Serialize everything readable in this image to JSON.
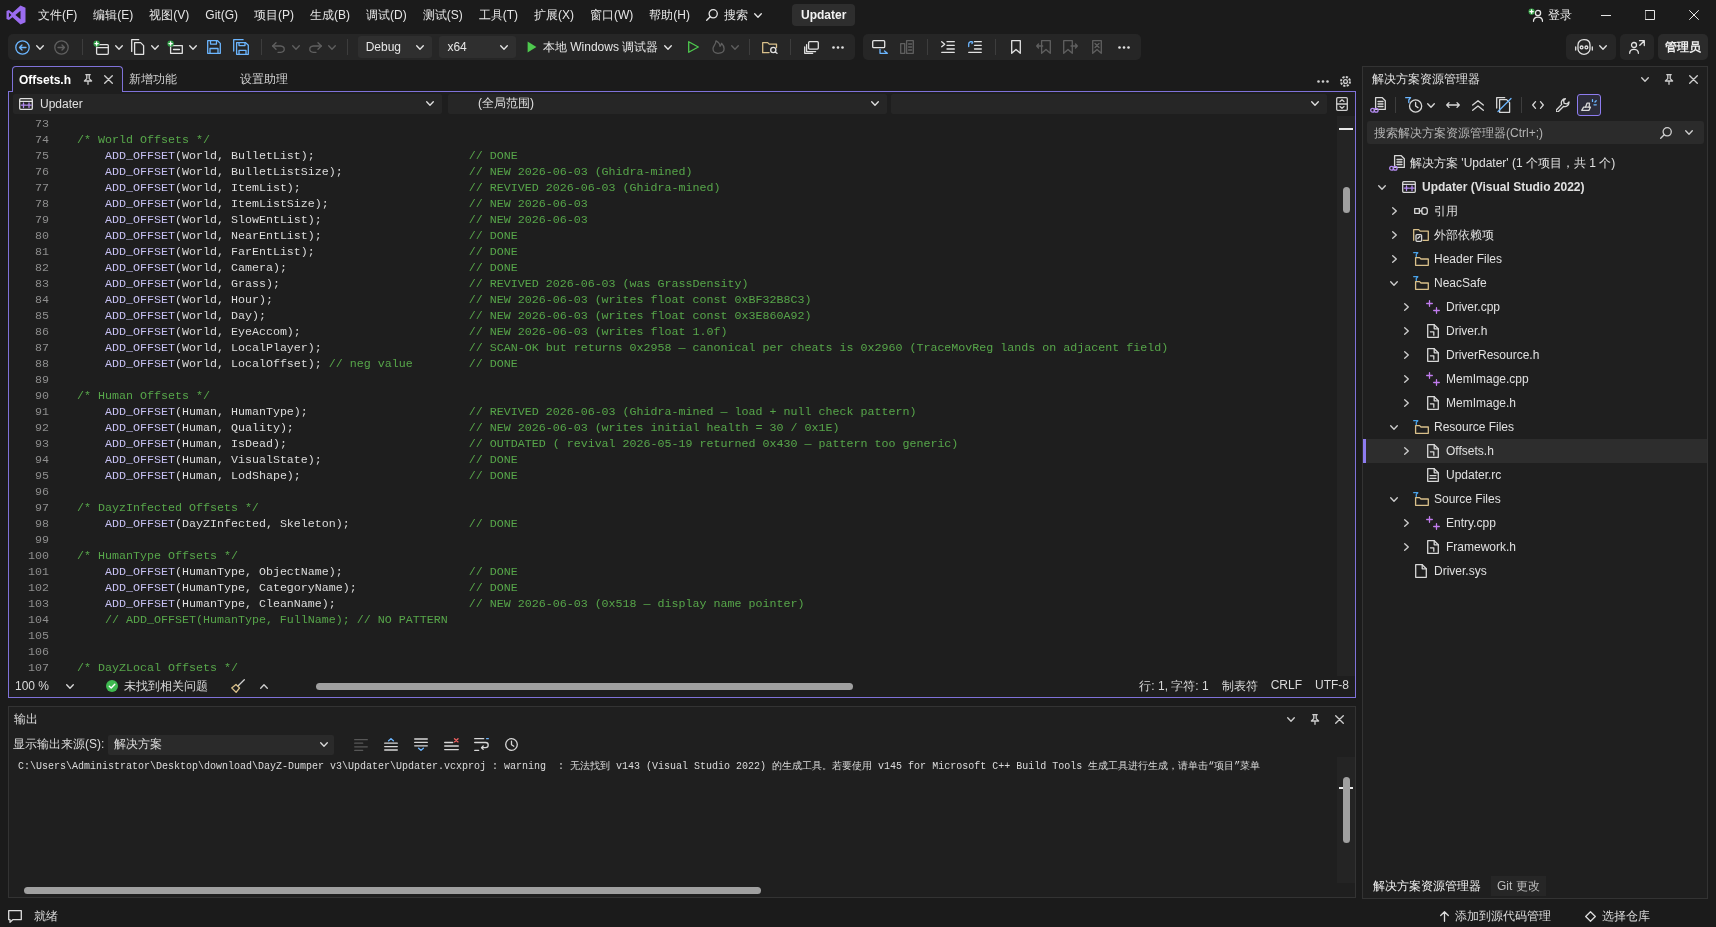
{
  "menu_bar": {
    "items": [
      "文件(F)",
      "编辑(E)",
      "视图(V)",
      "Git(G)",
      "项目(P)",
      "生成(B)",
      "调试(D)",
      "测试(S)",
      "工具(T)",
      "扩展(X)",
      "窗口(W)",
      "帮助(H)"
    ],
    "search": "搜索",
    "solution_name": "Updater",
    "sign_in": "登录"
  },
  "toolbar": {
    "items": [
      {
        "kind": "back",
        "disabled": false
      },
      {
        "kind": "forward",
        "disabled": true
      },
      {
        "kind": "separator"
      },
      {
        "kind": "new-project",
        "disabled": false
      },
      {
        "kind": "open-file",
        "disabled": false
      },
      {
        "kind": "add-item",
        "disabled": false
      },
      {
        "kind": "save",
        "disabled": false
      },
      {
        "kind": "save-all",
        "disabled": false
      },
      {
        "kind": "separator"
      },
      {
        "kind": "undo",
        "disabled": true
      },
      {
        "kind": "redo",
        "disabled": true
      },
      {
        "kind": "separator"
      },
      {
        "kind": "configuration",
        "value": "Debug"
      },
      {
        "kind": "platform",
        "value": "x64"
      },
      {
        "kind": "start",
        "label": "本地 Windows 调试器"
      },
      {
        "kind": "start-without-debugging",
        "disabled": false
      },
      {
        "kind": "hot-reload",
        "disabled": true
      },
      {
        "kind": "separator"
      },
      {
        "kind": "find-in-files",
        "disabled": false
      },
      {
        "kind": "separator"
      },
      {
        "kind": "window",
        "disabled": false
      },
      {
        "kind": "more"
      }
    ],
    "editor_items": [
      {
        "kind": "comment",
        "disabled": false
      },
      {
        "kind": "uncomment",
        "disabled": true
      },
      {
        "kind": "separator"
      },
      {
        "kind": "outdent",
        "disabled": false
      },
      {
        "kind": "indent",
        "disabled": false
      },
      {
        "kind": "separator"
      },
      {
        "kind": "bookmark",
        "disabled": false
      },
      {
        "kind": "previous-bookmark",
        "disabled": true
      },
      {
        "kind": "next-bookmark",
        "disabled": true
      },
      {
        "kind": "clear-bookmarks",
        "disabled": true
      },
      {
        "kind": "more"
      }
    ],
    "account": "管理员"
  },
  "document_tabs": [
    {
      "label": "Offsets.h",
      "selected": true
    },
    {
      "label": "新增功能",
      "selected": false
    },
    {
      "label": "设置助理",
      "selected": false
    }
  ],
  "editor": {
    "navigation": {
      "project": "Updater",
      "scope": "(全局范围)"
    },
    "lines": [
      {
        "number": "73",
        "kind": "blank"
      },
      {
        "number": "74",
        "kind": "heading",
        "text": "/* World Offsets */"
      },
      {
        "number": "75",
        "kind": "call",
        "macro": "ADD_OFFSET",
        "args": "(World, BulletList);",
        "note": "// DONE"
      },
      {
        "number": "76",
        "kind": "call",
        "macro": "ADD_OFFSET",
        "args": "(World, BulletListSize);",
        "note": "// NEW 2026-06-03 (Ghidra-mined)"
      },
      {
        "number": "77",
        "kind": "call",
        "macro": "ADD_OFFSET",
        "args": "(World, ItemList);",
        "note": "// REVIVED 2026-06-03 (Ghidra-mined)"
      },
      {
        "number": "78",
        "kind": "call",
        "macro": "ADD_OFFSET",
        "args": "(World, ItemListSize);",
        "note": "// NEW 2026-06-03"
      },
      {
        "number": "79",
        "kind": "call",
        "macro": "ADD_OFFSET",
        "args": "(World, SlowEntList);",
        "note": "// NEW 2026-06-03"
      },
      {
        "number": "80",
        "kind": "call",
        "macro": "ADD_OFFSET",
        "args": "(World, NearEntList);",
        "note": "// DONE"
      },
      {
        "number": "81",
        "kind": "call",
        "macro": "ADD_OFFSET",
        "args": "(World, FarEntList);",
        "note": "// DONE"
      },
      {
        "number": "82",
        "kind": "call",
        "macro": "ADD_OFFSET",
        "args": "(World, Camera);",
        "note": "// DONE"
      },
      {
        "number": "83",
        "kind": "call",
        "macro": "ADD_OFFSET",
        "args": "(World, Grass);",
        "note": "// REVIVED 2026-06-03 (was GrassDensity)"
      },
      {
        "number": "84",
        "kind": "call",
        "macro": "ADD_OFFSET",
        "args": "(World, Hour);",
        "note": "// NEW 2026-06-03 (writes float const 0xBF32B8C3)"
      },
      {
        "number": "85",
        "kind": "call",
        "macro": "ADD_OFFSET",
        "args": "(World, Day);",
        "note": "// NEW 2026-06-03 (writes float const 0x3E860A92)"
      },
      {
        "number": "86",
        "kind": "call",
        "macro": "ADD_OFFSET",
        "args": "(World, EyeAccom);",
        "note": "// NEW 2026-06-03 (writes float 1.0f)"
      },
      {
        "number": "87",
        "kind": "call",
        "macro": "ADD_OFFSET",
        "args": "(World, LocalPlayer);",
        "note": "// SCAN-OK but returns 0x2958 — canonical per cheats is 0x2960 (TraceMovReg lands on adjacent field)"
      },
      {
        "number": "88",
        "kind": "call",
        "macro": "ADD_OFFSET",
        "args": "(World, LocalOffset);",
        "inline_comment": "// neg value",
        "note": "// DONE"
      },
      {
        "number": "89",
        "kind": "blank"
      },
      {
        "number": "90",
        "kind": "heading",
        "text": "/* Human Offsets */"
      },
      {
        "number": "91",
        "kind": "call",
        "macro": "ADD_OFFSET",
        "args": "(Human, HumanType);",
        "note": "// REVIVED 2026-06-03 (Ghidra-mined — load + null check pattern)"
      },
      {
        "number": "92",
        "kind": "call",
        "macro": "ADD_OFFSET",
        "args": "(Human, Quality);",
        "note": "// NEW 2026-06-03 (writes initial health = 30 / 0x1E)"
      },
      {
        "number": "93",
        "kind": "call",
        "macro": "ADD_OFFSET",
        "args": "(Human, IsDead);",
        "note": "// OUTDATED ( revival 2026-05-19 returned 0x430 — pattern too generic)"
      },
      {
        "number": "94",
        "kind": "call",
        "macro": "ADD_OFFSET",
        "args": "(Human, VisualState);",
        "note": "// DONE"
      },
      {
        "number": "95",
        "kind": "call",
        "macro": "ADD_OFFSET",
        "args": "(Human, LodShape);",
        "note": "// DONE"
      },
      {
        "number": "96",
        "kind": "blank"
      },
      {
        "number": "97",
        "kind": "heading",
        "text": "/* DayzInfected Offsets */"
      },
      {
        "number": "98",
        "kind": "call",
        "macro": "ADD_OFFSET",
        "args": "(DayZInfected, Skeleton);",
        "note": "// DONE"
      },
      {
        "number": "99",
        "kind": "blank"
      },
      {
        "number": "100",
        "kind": "heading",
        "text": "/* HumanType Offsets */"
      },
      {
        "number": "101",
        "kind": "call",
        "macro": "ADD_OFFSET",
        "args": "(HumanType, ObjectName);",
        "note": "// DONE"
      },
      {
        "number": "102",
        "kind": "call",
        "macro": "ADD_OFFSET",
        "args": "(HumanType, CategoryName);",
        "note": "// DONE"
      },
      {
        "number": "103",
        "kind": "call",
        "macro": "ADD_OFFSET",
        "args": "(HumanType, CleanName);",
        "note": "// NEW 2026-06-03 (0x518 — display name pointer)"
      },
      {
        "number": "104",
        "kind": "disabled",
        "text": "// ADD_OFFSET(HumanType, FullName); // NO PATTERN"
      },
      {
        "number": "105",
        "kind": "blank"
      },
      {
        "number": "106",
        "kind": "blank"
      },
      {
        "number": "107",
        "kind": "heading",
        "text": "/* DayZLocal Offsets */"
      }
    ],
    "status": {
      "zoom": "100 %",
      "issues": "未找到相关问题",
      "position": "行: 1, 字符: 1",
      "indentation": "制表符",
      "line_ending": "CRLF",
      "encoding": "UTF-8"
    }
  },
  "output": {
    "title": "输出",
    "source_label": "显示输出来源(S):",
    "source": "解决方案",
    "toolbar": [
      {
        "kind": "align",
        "disabled": true
      },
      {
        "kind": "previous",
        "disabled": false
      },
      {
        "kind": "next",
        "disabled": false
      },
      {
        "kind": "clear",
        "disabled": false
      },
      {
        "kind": "wrap",
        "disabled": false
      },
      {
        "kind": "timestamp",
        "disabled": false
      }
    ],
    "lines": [
      "C:\\Users\\Administrator\\Desktop\\download\\DayZ-Dumper v3\\Updater\\Updater.vcxproj : warning  : 无法找到 v143 (Visual Studio 2022) 的生成工具。若要使用 v145 for Microsoft C++ Build Tools 生成工具进行生成，请单击“项目”菜单"
    ]
  },
  "solution_explorer": {
    "title": "解决方案资源管理器",
    "toolbar": [
      {
        "kind": "switch-views",
        "on": false
      },
      {
        "kind": "pending-changes",
        "on": false
      },
      {
        "kind": "sync",
        "on": false
      },
      {
        "kind": "collapse",
        "on": false
      },
      {
        "kind": "show-all",
        "on": false
      },
      {
        "kind": "view-code",
        "on": false
      },
      {
        "kind": "properties",
        "on": false
      },
      {
        "kind": "preview",
        "on": true
      }
    ],
    "search": {
      "placeholder": "搜索解决方案资源管理器(Ctrl+;)"
    },
    "tree": [
      {
        "label": "解决方案 'Updater' (1 个项目，共 1 个)",
        "kind": "solution",
        "selected": false,
        "children": [
          {
            "label": "Updater (Visual Studio 2022)",
            "kind": "project",
            "expanded": true,
            "selected": false,
            "children": [
              {
                "label": "引用",
                "kind": "references",
                "expanded": false,
                "selected": false
              },
              {
                "label": "外部依赖项",
                "kind": "dependencies",
                "expanded": false,
                "selected": false
              },
              {
                "label": "Header Files",
                "kind": "filter",
                "expanded": false,
                "selected": false
              },
              {
                "label": "NeacSafe",
                "kind": "filter",
                "expanded": true,
                "selected": false,
                "children": [
                  {
                    "label": "Driver.cpp",
                    "kind": "cpp",
                    "expanded": false,
                    "selected": false
                  },
                  {
                    "label": "Driver.h",
                    "kind": "header",
                    "expanded": false,
                    "selected": false
                  },
                  {
                    "label": "DriverResource.h",
                    "kind": "header",
                    "expanded": false,
                    "selected": false
                  },
                  {
                    "label": "MemImage.cpp",
                    "kind": "cpp",
                    "expanded": false,
                    "selected": false
                  },
                  {
                    "label": "MemImage.h",
                    "kind": "header",
                    "expanded": false,
                    "selected": false
                  }
                ]
              },
              {
                "label": "Resource Files",
                "kind": "filter",
                "expanded": true,
                "selected": false,
                "children": [
                  {
                    "label": "Offsets.h",
                    "kind": "header",
                    "expanded": false,
                    "selected": true
                  },
                  {
                    "label": "Updater.rc",
                    "kind": "resource",
                    "selected": false
                  }
                ]
              },
              {
                "label": "Source Files",
                "kind": "filter",
                "expanded": true,
                "selected": false,
                "children": [
                  {
                    "label": "Entry.cpp",
                    "kind": "cpp",
                    "expanded": false,
                    "selected": false
                  },
                  {
                    "label": "Framework.h",
                    "kind": "header",
                    "expanded": false,
                    "selected": false
                  }
                ]
              },
              {
                "label": "Driver.sys",
                "kind": "file",
                "selected": false
              }
            ]
          }
        ]
      }
    ],
    "tabs": [
      {
        "label": "解决方案资源管理器",
        "selected": true
      },
      {
        "label": "Git 更改",
        "selected": false
      }
    ]
  },
  "status_bar": {
    "state": "就绪",
    "source_control": "添加到源代码管理",
    "repository": "选择仓库"
  }
}
